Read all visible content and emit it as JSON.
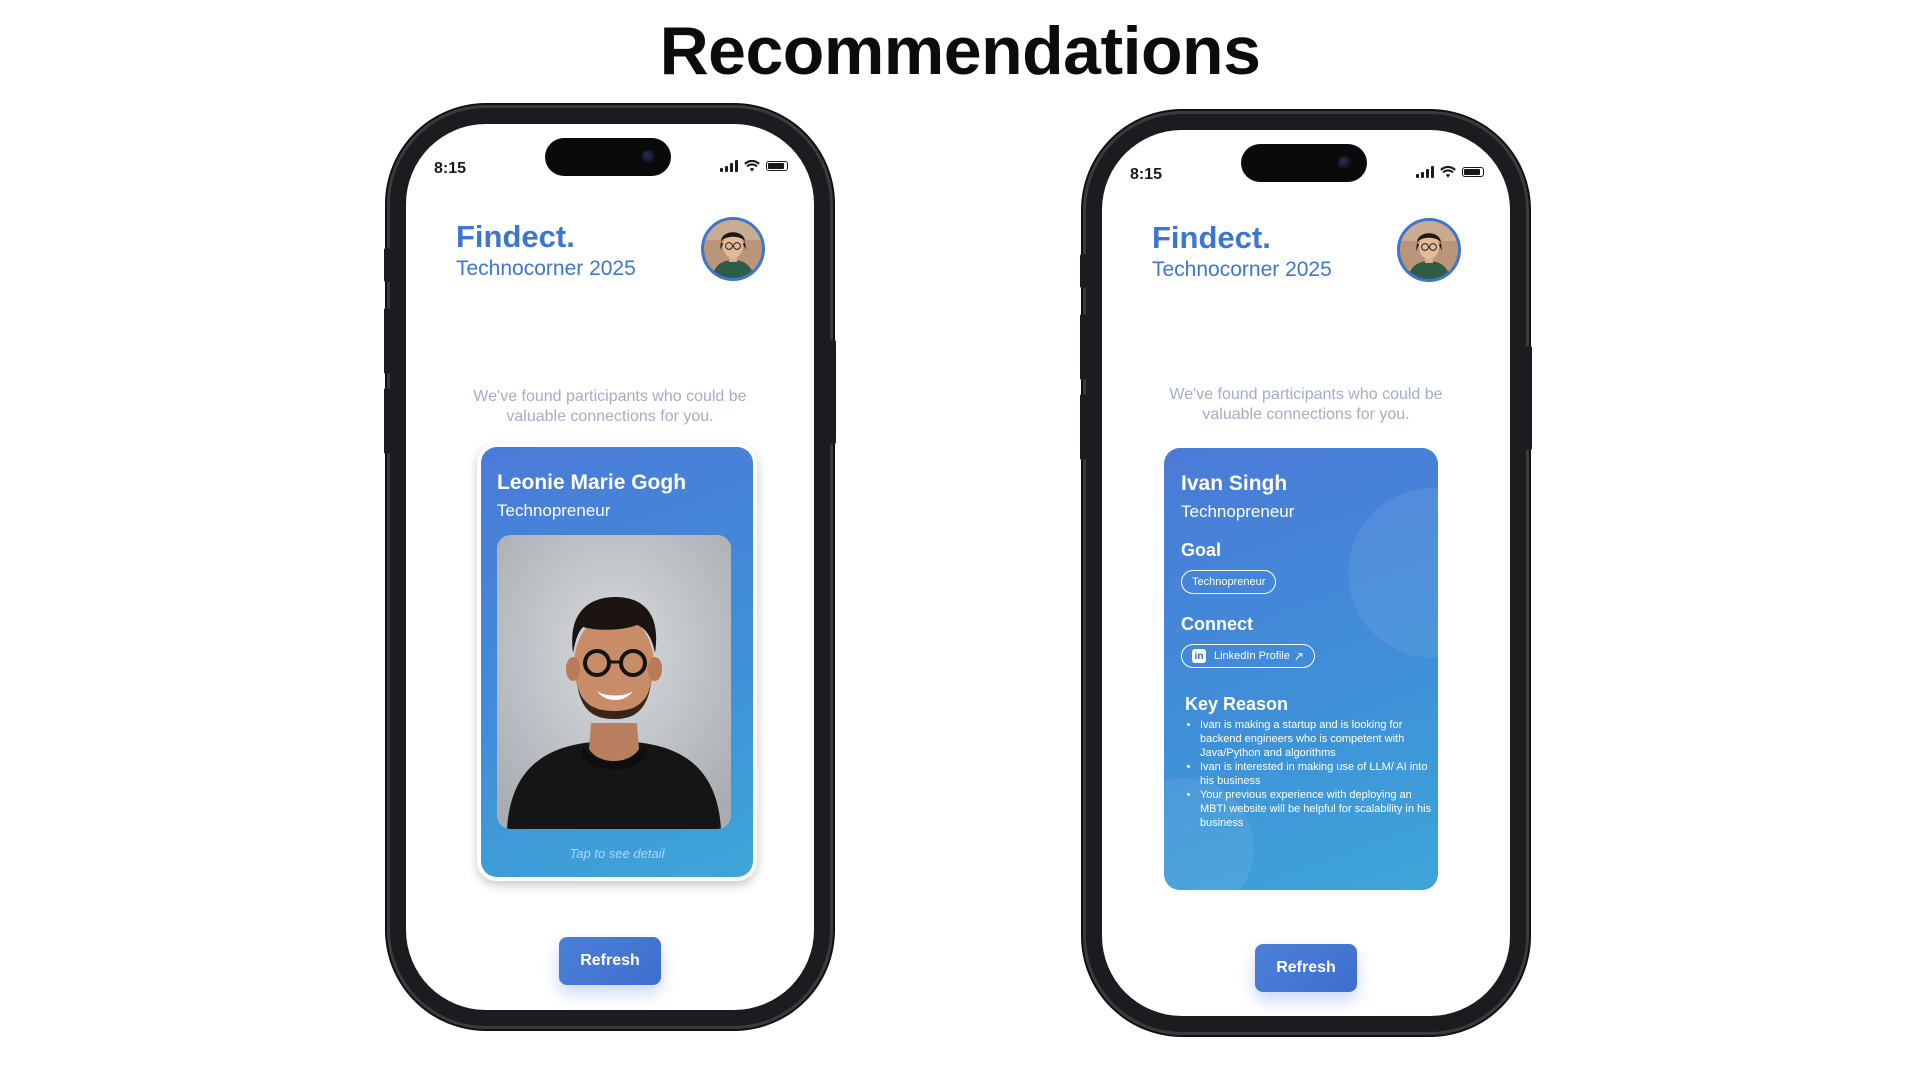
{
  "page": {
    "title": "Recommendations"
  },
  "phones": [
    {
      "status": {
        "time": "8:15"
      },
      "header": {
        "brand": "Findect.",
        "event": "Technocorner 2025"
      },
      "intro": "We've found participants who could be valuable connections for you.",
      "card": {
        "name": "Leonie Marie Gogh",
        "role": "Technopreneur",
        "hint": "Tap to see detail"
      },
      "refresh_label": "Refresh"
    },
    {
      "status": {
        "time": "8:15"
      },
      "header": {
        "brand": "Findect.",
        "event": "Technocorner 2025"
      },
      "intro": "We've found participants who could be valuable connections for you.",
      "card": {
        "name": "Ivan Singh",
        "role": "Technopreneur",
        "goal_label": "Goal",
        "goal_tag": "Technopreneur",
        "connect_label": "Connect",
        "linkedin_label": "LinkedIn Profile",
        "linkedin_badge": "in",
        "linkedin_arrow": "↗",
        "key_reason_label": "Key Reason",
        "reasons": [
          "Ivan is making a startup and is looking for backend engineers who is competent with Java/Python and algorithms",
          "Ivan is interested in making use of LLM/ AI into his business",
          "Your previous experience with deploying an MBTI website will be helpful for scalability in his business"
        ]
      },
      "refresh_label": "Refresh"
    }
  ],
  "colors": {
    "accent": "#3d76cf",
    "muted_text": "#a2adc3",
    "card_gradient_start": "#4b7ad8",
    "card_gradient_end": "#3ea6d8"
  },
  "icons": [
    "signal-icon",
    "wifi-icon",
    "battery-icon",
    "avatar",
    "linkedin-icon",
    "external-link-icon"
  ]
}
